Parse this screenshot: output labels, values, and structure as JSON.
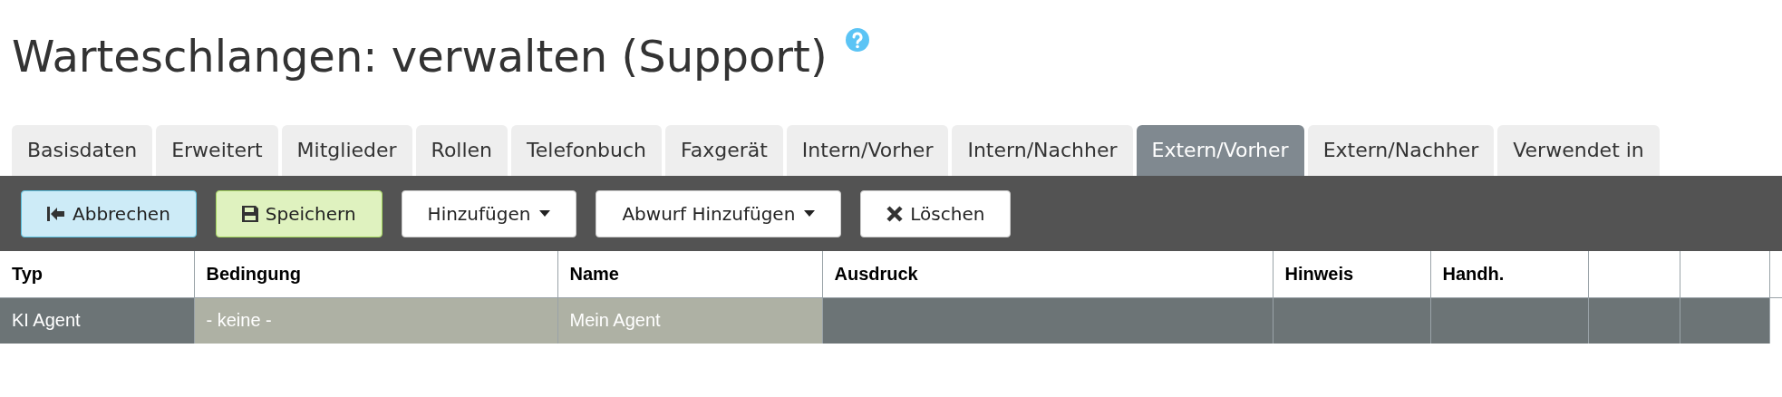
{
  "page": {
    "title": "Warteschlangen: verwalten (Support)",
    "help": true
  },
  "tabs": [
    {
      "label": "Basisdaten",
      "selected": false
    },
    {
      "label": "Erweitert",
      "selected": false
    },
    {
      "label": "Mitglieder",
      "selected": false
    },
    {
      "label": "Rollen",
      "selected": false
    },
    {
      "label": "Telefonbuch",
      "selected": false
    },
    {
      "label": "Faxgerät",
      "selected": false
    },
    {
      "label": "Intern/Vorher",
      "selected": false
    },
    {
      "label": "Intern/Nachher",
      "selected": false
    },
    {
      "label": "Extern/Vorher",
      "selected": true
    },
    {
      "label": "Extern/Nachher",
      "selected": false
    },
    {
      "label": "Verwendet in",
      "selected": false
    }
  ],
  "toolbar": [
    {
      "label": "Abbrechen",
      "kind": "cancel",
      "dropdown": false
    },
    {
      "label": "Speichern",
      "kind": "save",
      "dropdown": false
    },
    {
      "label": "Hinzufügen",
      "kind": "plain",
      "dropdown": true
    },
    {
      "label": "Abwurf Hinzufügen",
      "kind": "plain",
      "dropdown": true
    },
    {
      "label": "Löschen",
      "kind": "delete",
      "dropdown": false
    }
  ],
  "table": {
    "columns": [
      "Typ",
      "Bedingung",
      "Name",
      "Ausdruck",
      "Hinweis",
      "Handh."
    ],
    "rows": [
      {
        "cells": [
          {
            "text": "KI Agent",
            "highlighted": false
          },
          {
            "text": "- keine -",
            "highlighted": true
          },
          {
            "text": "Mein Agent",
            "highlighted": true
          },
          {
            "text": "",
            "highlighted": false
          },
          {
            "text": "",
            "highlighted": false
          },
          {
            "text": "",
            "highlighted": false
          },
          {
            "text": "",
            "highlighted": false
          },
          {
            "text": "",
            "highlighted": false
          }
        ]
      }
    ]
  }
}
